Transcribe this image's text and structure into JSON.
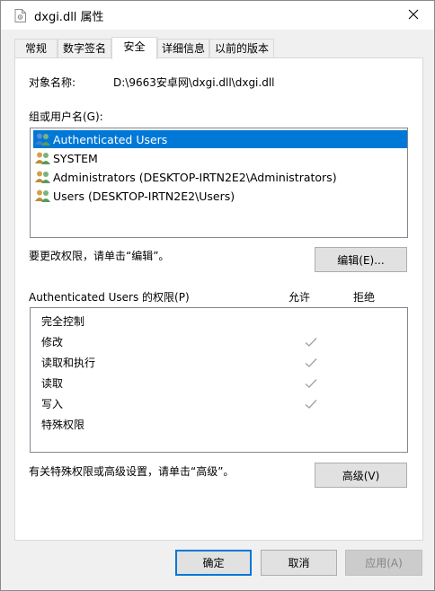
{
  "window": {
    "title": "dxgi.dll 属性",
    "icon": "file-icon",
    "close_icon": "close-icon"
  },
  "tabs": [
    {
      "label": "常规",
      "active": false
    },
    {
      "label": "数字签名",
      "active": false
    },
    {
      "label": "安全",
      "active": true
    },
    {
      "label": "详细信息",
      "active": false
    },
    {
      "label": "以前的版本",
      "active": false
    }
  ],
  "security": {
    "object_name_label": "对象名称:",
    "object_name_value": "D:\\9663安卓网\\dxgi.dll\\dxgi.dll",
    "groups_label": "组或用户名(G):",
    "users": [
      {
        "name": "Authenticated Users",
        "selected": true,
        "icon": "users-group-icon"
      },
      {
        "name": "SYSTEM",
        "selected": false,
        "icon": "users-group-icon"
      },
      {
        "name": "Administrators (DESKTOP-IRTN2E2\\Administrators)",
        "selected": false,
        "icon": "users-group-icon"
      },
      {
        "name": "Users (DESKTOP-IRTN2E2\\Users)",
        "selected": false,
        "icon": "users-group-icon"
      }
    ],
    "change_hint": "要更改权限，请单击“编辑”。",
    "edit_button": "编辑(E)...",
    "permissions_label": "Authenticated Users 的权限(P)",
    "allow_header": "允许",
    "deny_header": "拒绝",
    "permissions": [
      {
        "name": "完全控制",
        "allow": false,
        "deny": false
      },
      {
        "name": "修改",
        "allow": true,
        "deny": false
      },
      {
        "name": "读取和执行",
        "allow": true,
        "deny": false
      },
      {
        "name": "读取",
        "allow": true,
        "deny": false
      },
      {
        "name": "写入",
        "allow": true,
        "deny": false
      },
      {
        "name": "特殊权限",
        "allow": false,
        "deny": false
      }
    ],
    "advanced_hint": "有关特殊权限或高级设置，请单击“高级”。",
    "advanced_button": "高级(V)"
  },
  "footer": {
    "ok_button": "确定",
    "cancel_button": "取消",
    "apply_button": "应用(A)"
  },
  "colors": {
    "selection": "#0078d7",
    "window_bg": "#f0f0f0",
    "panel_bg": "#ffffff",
    "check_color": "#a0a0a0"
  }
}
